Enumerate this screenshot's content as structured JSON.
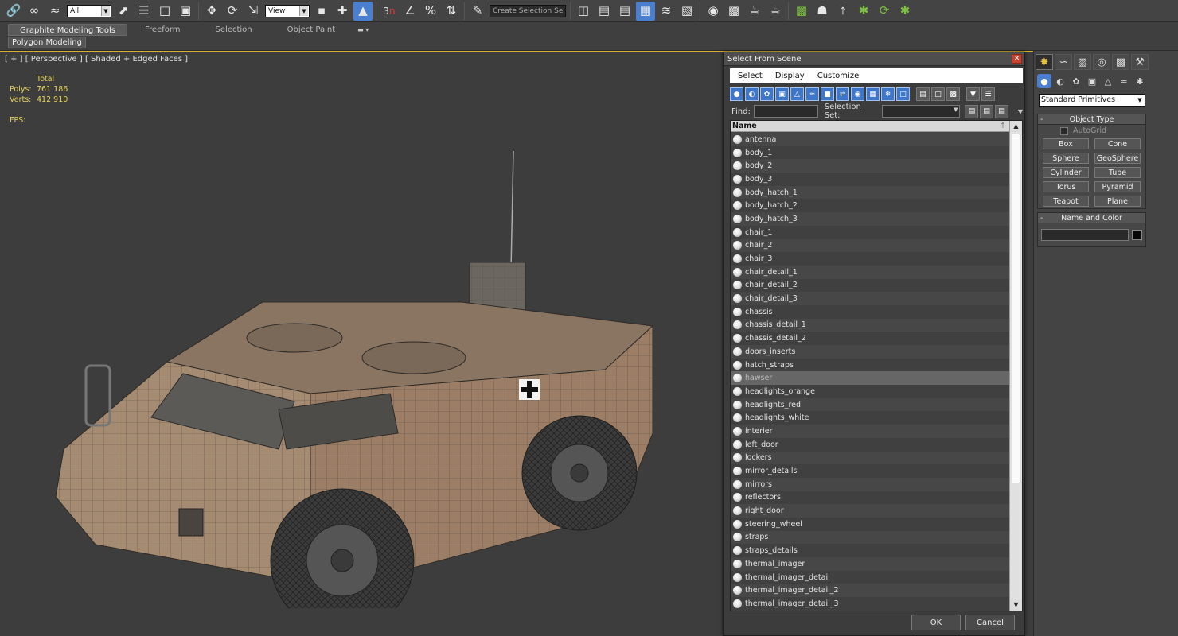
{
  "toolbar": {
    "filter": "All",
    "ref_coord": "View",
    "snap_number": "3",
    "selection_set_placeholder": "Create Selection Se"
  },
  "ribbon": {
    "tabs": [
      "Graphite Modeling Tools",
      "Freeform",
      "Selection",
      "Object Paint"
    ],
    "active_tab": 0,
    "panel_label": "Polygon Modeling"
  },
  "viewport": {
    "label": "[ + ] [ Perspective ] [ Shaded + Edged Faces ]",
    "stats": {
      "header": "Total",
      "polys_label": "Polys:",
      "polys_value": "761 186",
      "verts_label": "Verts:",
      "verts_value": "412 910",
      "fps_label": "FPS:"
    }
  },
  "dialog": {
    "title": "Select From Scene",
    "menu": [
      "Select",
      "Display",
      "Customize"
    ],
    "find_label": "Find:",
    "selection_set_label": "Selection Set:",
    "column_name": "Name",
    "objects": [
      "antenna",
      "body_1",
      "body_2",
      "body_3",
      "body_hatch_1",
      "body_hatch_2",
      "body_hatch_3",
      "chair_1",
      "chair_2",
      "chair_3",
      "chair_detail_1",
      "chair_detail_2",
      "chair_detail_3",
      "chassis",
      "chassis_detail_1",
      "chassis_detail_2",
      "doors_inserts",
      "hatch_straps",
      "hawser",
      "headlights_orange",
      "headlights_red",
      "headlights_white",
      "interier",
      "left_door",
      "lockers",
      "mirror_details",
      "mirrors",
      "reflectors",
      "right_door",
      "steering_wheel",
      "straps",
      "straps_details",
      "thermal_imager",
      "thermal_imager_detail",
      "thermal_imager_detail_2",
      "thermal_imager_detail_3"
    ],
    "selected_index": 18,
    "ok_label": "OK",
    "cancel_label": "Cancel"
  },
  "command_panel": {
    "category": "Standard Primitives",
    "object_type_title": "Object Type",
    "autogrid_label": "AutoGrid",
    "primitives": [
      "Box",
      "Cone",
      "Sphere",
      "GeoSphere",
      "Cylinder",
      "Tube",
      "Torus",
      "Pyramid",
      "Teapot",
      "Plane"
    ],
    "name_color_title": "Name and Color",
    "object_color": "#080808"
  },
  "colors": {
    "accent": "#4a7fcf",
    "viewport_border": "#d8b030",
    "stats_text": "#e6d35a",
    "close_button": "#c8412f"
  }
}
